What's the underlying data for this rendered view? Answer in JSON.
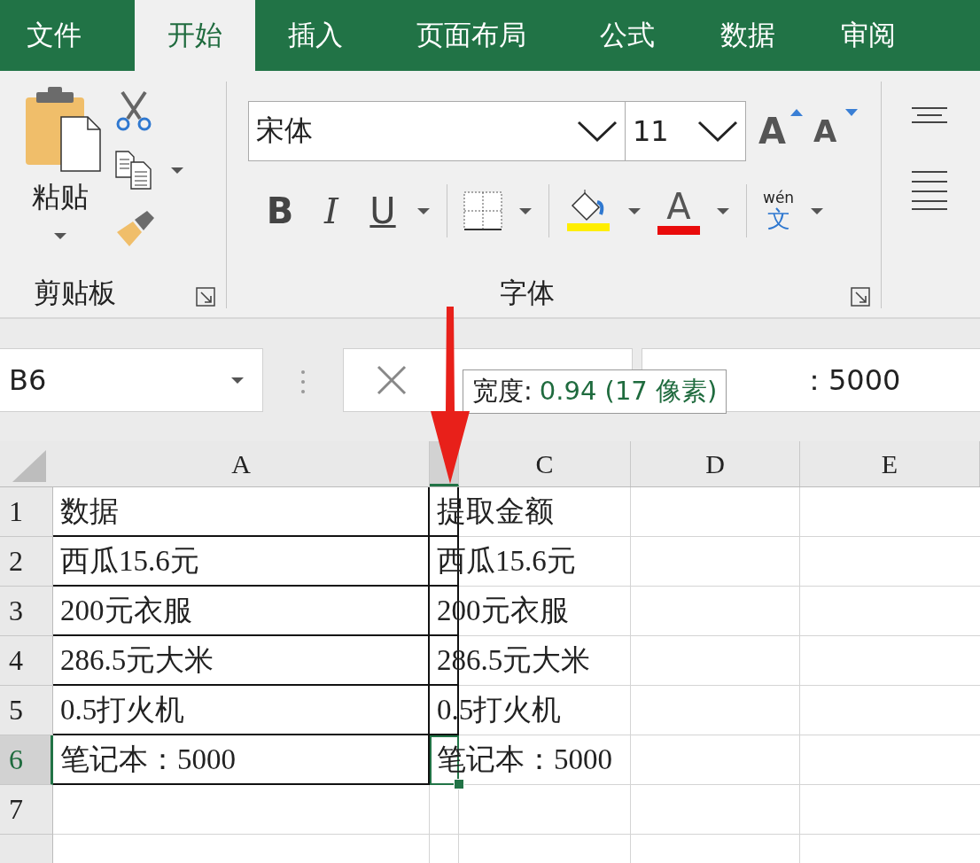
{
  "ribbon_tabs": [
    {
      "label": "文件",
      "selected": false
    },
    {
      "label": "开始",
      "selected": true
    },
    {
      "label": "插入",
      "selected": false
    },
    {
      "label": "页面布局",
      "selected": false
    },
    {
      "label": "公式",
      "selected": false
    },
    {
      "label": "数据",
      "selected": false
    },
    {
      "label": "审阅",
      "selected": false
    }
  ],
  "clipboard_group": {
    "paste_label": "粘贴",
    "group_label": "剪贴板"
  },
  "font_group": {
    "font_name": "宋体",
    "font_size": "11",
    "grow_label": "A",
    "shrink_label": "A",
    "bold_label": "B",
    "italic_label": "I",
    "underline_label": "U",
    "font_color_label": "A",
    "phonetic_pinyin": "wén",
    "phonetic_char": "文",
    "group_label": "字体"
  },
  "formula_bar": {
    "name_box": "B6",
    "formula_text": "：5000"
  },
  "tooltip": {
    "label": "宽度:",
    "value": "0.94 (17 像素)"
  },
  "sheet": {
    "columns": [
      {
        "label": "A",
        "selected": false
      },
      {
        "selected": true
      },
      {
        "label": "C",
        "selected": false
      },
      {
        "label": "D",
        "selected": false
      },
      {
        "label": "E",
        "selected": false
      }
    ],
    "rows": [
      {
        "label": "1",
        "selected": false,
        "cells": [
          {
            "text": "数据",
            "selected": false
          },
          {
            "text": "提取金额",
            "selected": false
          }
        ]
      },
      {
        "label": "2",
        "selected": false,
        "cells": [
          {
            "text": "西瓜15.6元",
            "selected": false
          },
          {
            "text": "西瓜15.6元",
            "selected": false
          }
        ]
      },
      {
        "label": "3",
        "selected": false,
        "cells": [
          {
            "text": "200元衣服",
            "selected": false
          },
          {
            "text": "200元衣服",
            "selected": false
          }
        ]
      },
      {
        "label": "4",
        "selected": false,
        "cells": [
          {
            "text": "286.5元大米",
            "selected": false
          },
          {
            "text": "286.5元大米",
            "selected": false
          }
        ]
      },
      {
        "label": "5",
        "selected": false,
        "cells": [
          {
            "text": "0.5打火机",
            "selected": false
          },
          {
            "text": "0.5打火机",
            "selected": false
          }
        ]
      },
      {
        "label": "6",
        "selected": true,
        "cells": [
          {
            "text": "笔记本：5000",
            "selected": false
          },
          {
            "text": "笔记本：5000",
            "selected": true
          }
        ]
      },
      {
        "label": "7",
        "selected": false
      }
    ]
  }
}
